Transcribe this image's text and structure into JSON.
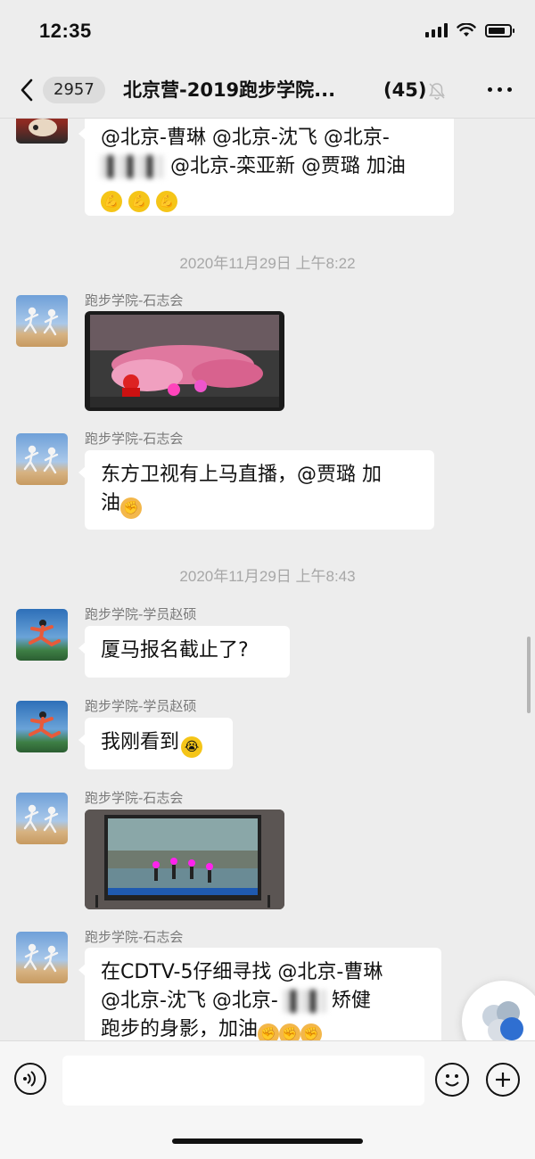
{
  "status_bar": {
    "time": "12:35"
  },
  "nav": {
    "unread_count": "2957",
    "title": "北京营-2019跑步学院...",
    "member_count": "(45)"
  },
  "chat": {
    "msg0": {
      "line1": "@北京-曹琳 @北京-沈飞 @北京-",
      "line2": "@北京-栾亚新 @贾璐 加油"
    },
    "ts1": "2020年11月29日 上午8:22",
    "msg1": {
      "sender": "跑步学院-石志会"
    },
    "msg2": {
      "sender": "跑步学院-石志会",
      "line1": "东方卫视有上马直播，@贾璐 加",
      "line2": "油"
    },
    "ts2": "2020年11月29日 上午8:43",
    "msg3": {
      "sender": "跑步学院-学员赵硕",
      "text": "厦马报名截止了?"
    },
    "msg4": {
      "sender": "跑步学院-学员赵硕",
      "text": "我刚看到"
    },
    "msg5": {
      "sender": "跑步学院-石志会"
    },
    "msg6": {
      "sender": "跑步学院-石志会",
      "line1a": "在CDTV-5仔细寻找 @北京-曹琳",
      "line2a": "@北京-沈飞 @北京-",
      "line2b": "矫健",
      "line3": "跑步的身影，加油"
    }
  },
  "colors": {
    "background": "#ededed",
    "bubble": "#ffffff",
    "timestamp": "#a7a7a7",
    "sender": "#7a7a7a"
  },
  "icons": [
    "back-icon",
    "mute-icon",
    "more-icon",
    "voice-icon",
    "emoji-icon",
    "plus-icon",
    "signal-icon",
    "wifi-icon",
    "battery-icon"
  ]
}
